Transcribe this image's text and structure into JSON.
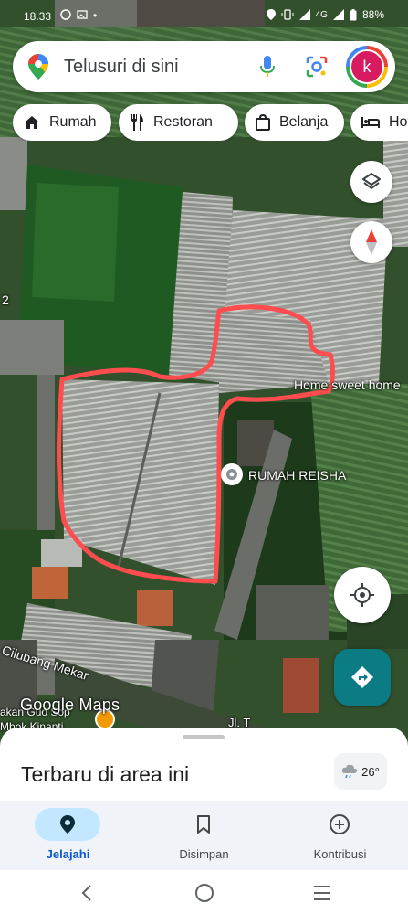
{
  "status_bar": {
    "time": "18.33",
    "network": "4G",
    "battery": "88%"
  },
  "search": {
    "placeholder": "Telusuri di sini",
    "avatar_letter": "k",
    "icons": [
      "maps-pin-icon",
      "mic-icon",
      "lens-icon"
    ]
  },
  "chips": [
    {
      "label": "Rumah",
      "icon": "home-icon"
    },
    {
      "label": "Restoran",
      "icon": "restaurant-icon"
    },
    {
      "label": "Belanja",
      "icon": "shopping-icon"
    },
    {
      "label": "Hotel",
      "icon": "hotel-icon"
    }
  ],
  "map": {
    "labels": {
      "home_sweet_home": "Home sweet home",
      "rumah_reisha": "RUMAH REISHA",
      "cilubang_mekar": "Cilubang Mekar",
      "road_partial": "Jl. T",
      "edge_number": "2",
      "bottom_left_partial_1": "akan Guo Sop",
      "bottom_left_partial_2": "Mbok Kinanti"
    },
    "outline_color": "#ff4d4f",
    "google_logo": "Google Maps"
  },
  "sheet": {
    "title": "Terbaru di area ini",
    "temperature": "26°"
  },
  "bottom_nav": {
    "items": [
      {
        "label": "Jelajahi",
        "icon": "explore-pin-icon",
        "active": true
      },
      {
        "label": "Disimpan",
        "icon": "bookmark-icon",
        "active": false
      },
      {
        "label": "Kontribusi",
        "icon": "add-circle-icon",
        "active": false
      }
    ]
  },
  "colors": {
    "accent": "#0b57d0",
    "active_pill": "#c2e7ff",
    "directions_fab": "#0b7b84"
  }
}
